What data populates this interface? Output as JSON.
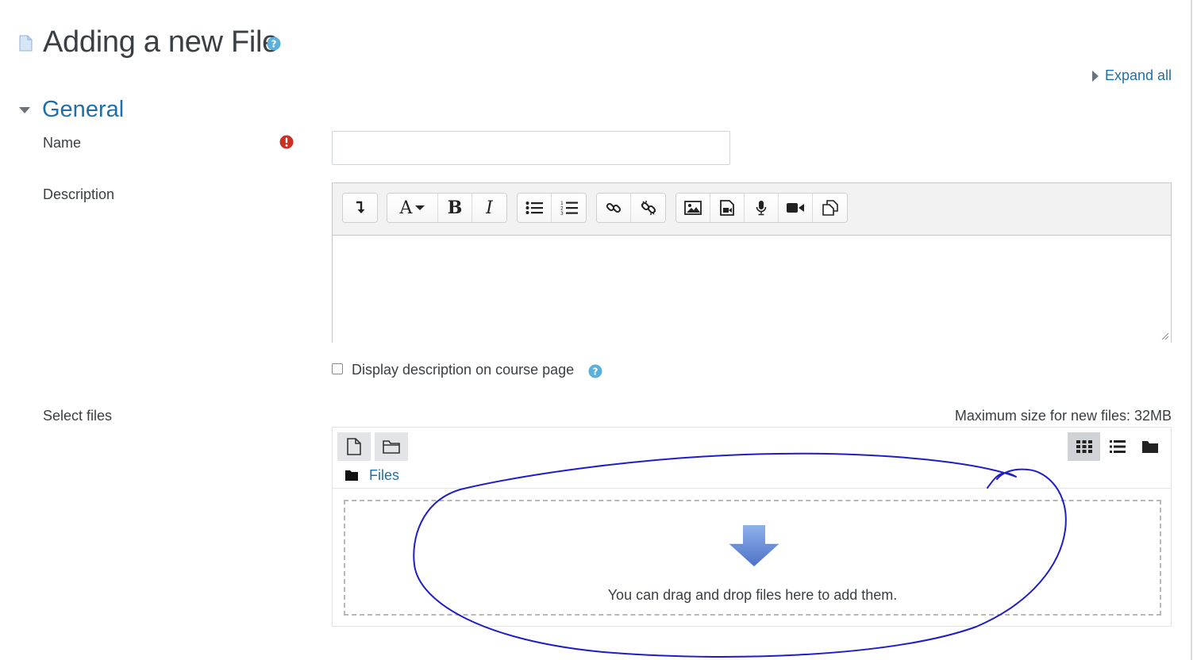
{
  "header": {
    "title": "Adding a new File",
    "expand_all_label": "Expand all"
  },
  "section": {
    "title": "General"
  },
  "form": {
    "name_label": "Name",
    "name_value": "",
    "description_label": "Description",
    "display_description_label": "Display description on course page",
    "display_description_checked": false,
    "select_files_label": "Select files",
    "max_size_text": "Maximum size for new files: 32MB"
  },
  "editor": {
    "toolbar_groups": [
      [
        "collapse-icon"
      ],
      [
        "font-style-icon",
        "bold-icon",
        "italic-icon"
      ],
      [
        "unordered-list-icon",
        "ordered-list-icon"
      ],
      [
        "link-icon",
        "unlink-icon"
      ],
      [
        "image-icon",
        "media-icon",
        "record-audio-icon",
        "record-video-icon",
        "manage-files-icon"
      ]
    ],
    "bold_glyph": "B",
    "italic_glyph": "I",
    "font_glyph": "A",
    "content": ""
  },
  "filemanager": {
    "breadcrumb_label": "Files",
    "dropzone_text": "You can drag and drop files here to add them.",
    "view_modes": [
      "icons-view",
      "list-view",
      "tree-view"
    ],
    "active_view": "icons-view"
  },
  "colors": {
    "link": "#1f6fa8",
    "required": "#ca3120",
    "help": "#5bb0d9",
    "annotation": "#1e1ec8"
  }
}
